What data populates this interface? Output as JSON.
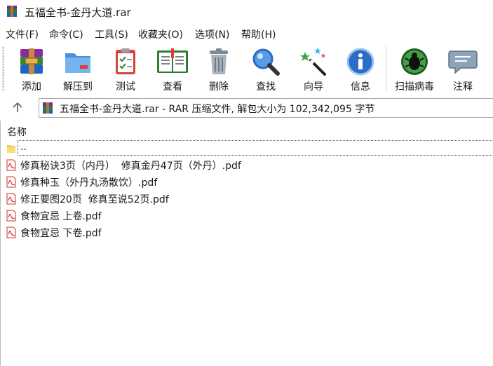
{
  "window": {
    "title": "五福全书-金丹大道.rar"
  },
  "menu": [
    "文件(F)",
    "命令(C)",
    "工具(S)",
    "收藏夹(O)",
    "选项(N)",
    "帮助(H)"
  ],
  "toolbar": {
    "buttons": [
      {
        "label": "添加",
        "icon": "add-archive-icon"
      },
      {
        "label": "解压到",
        "icon": "extract-folder-icon"
      },
      {
        "label": "测试",
        "icon": "test-clipboard-icon"
      },
      {
        "label": "查看",
        "icon": "view-book-icon"
      },
      {
        "label": "删除",
        "icon": "trash-icon"
      },
      {
        "label": "查找",
        "icon": "magnifier-icon"
      },
      {
        "label": "向导",
        "icon": "wizard-wand-icon"
      },
      {
        "label": "信息",
        "icon": "info-icon"
      },
      {
        "label": "扫描病毒",
        "icon": "virus-scan-bug-icon"
      },
      {
        "label": "注释",
        "icon": "comment-bubble-icon"
      }
    ]
  },
  "address": {
    "text": "五福全书-金丹大道.rar - RAR 压缩文件, 解包大小为 102,342,095 字节"
  },
  "file_list": {
    "column_name": "名称",
    "items": [
      {
        "name": "..",
        "type": "parent-folder"
      },
      {
        "name": "修真秘诀3页（内丹）  修真金丹47页（外丹）.pdf",
        "type": "pdf"
      },
      {
        "name": "修真种玉（外丹丸汤散饮）.pdf",
        "type": "pdf"
      },
      {
        "name": "修正要图20页  修真至说52页.pdf",
        "type": "pdf"
      },
      {
        "name": "食物宜忌 上卷.pdf",
        "type": "pdf"
      },
      {
        "name": "食物宜忌 下卷.pdf",
        "type": "pdf"
      }
    ]
  },
  "colors": {
    "accent_blue": "#2b6cc4",
    "pdf_red": "#d32f2f",
    "folder_yellow": "#f2c94c"
  }
}
